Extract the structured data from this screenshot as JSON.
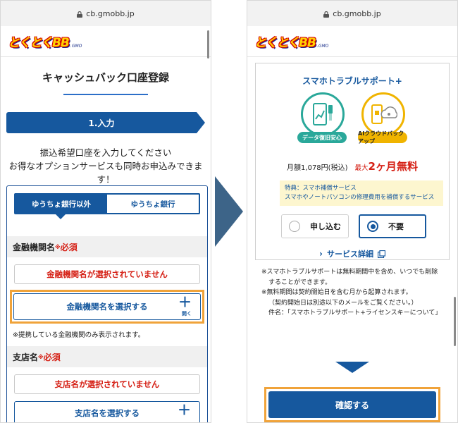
{
  "left": {
    "url": "cb.gmobb.jp",
    "logo": {
      "main": "とくとくBB",
      "sub": ".GMO"
    },
    "page_title": "キャッシュバック口座登録",
    "step_label": "1.入力",
    "intro_line1": "振込希望口座を入力してください",
    "intro_line2": "お得なオプションサービスも同時お申込みできます！",
    "tabs": [
      {
        "label": "ゆうちょ銀行以外",
        "active": true
      },
      {
        "label": "ゆうちょ銀行",
        "active": false
      }
    ],
    "bank_field": {
      "label": "金融機関名",
      "required_mark": "※",
      "required_label": "必須",
      "error": "金融機関名が選択されていません",
      "button": "金融機関名を選択する",
      "button_plus": "＋",
      "button_sub": "開く",
      "note": "※提携している金融機関のみ表示されます。"
    },
    "branch_field": {
      "label": "支店名",
      "required_mark": "※",
      "required_label": "必須",
      "error": "支店名が選択されていません",
      "button": "支店名を選択する",
      "button_plus": "＋"
    }
  },
  "right": {
    "url": "cb.gmobb.jp",
    "logo": {
      "main": "とくとくBB",
      "sub": ".GMO"
    },
    "service_title": "スマホトラブルサポート+",
    "badges": [
      {
        "label": "データ復旧安心",
        "icon": "phone-data-recovery-icon"
      },
      {
        "label": "AIクラウドバックアップ",
        "icon": "cloud-backup-icon"
      }
    ],
    "price": {
      "monthly": "月額1,078円(税込)",
      "max": "最大",
      "months": "2ヶ月",
      "free": "無料"
    },
    "perk_line1": "特典：スマホ補償サービス",
    "perk_line2": "スマホやノートパソコンの修理費用を補償するサービス",
    "options": [
      {
        "label": "申し込む",
        "selected": false
      },
      {
        "label": "不要",
        "selected": true
      }
    ],
    "detail_link": "サービス詳細",
    "notes": [
      "※スマホトラブルサポートは無料期間中を含め、いつでも削除することができます。",
      "※無料期間は契約開始日を含む月から起算されます。",
      "（契約開始日は別途以下のメールをご覧ください。）",
      "件名：「スマホトラブルサポート+ライセンスキーについて」"
    ],
    "confirm_button": "確認する"
  },
  "colors": {
    "brand_blue": "#16589e",
    "required_red": "#d51f14",
    "highlight_orange": "#f0a33a",
    "perk_bg": "#fdf6cf",
    "badge_teal": "#2aa89a",
    "badge_gold": "#f0b400"
  }
}
